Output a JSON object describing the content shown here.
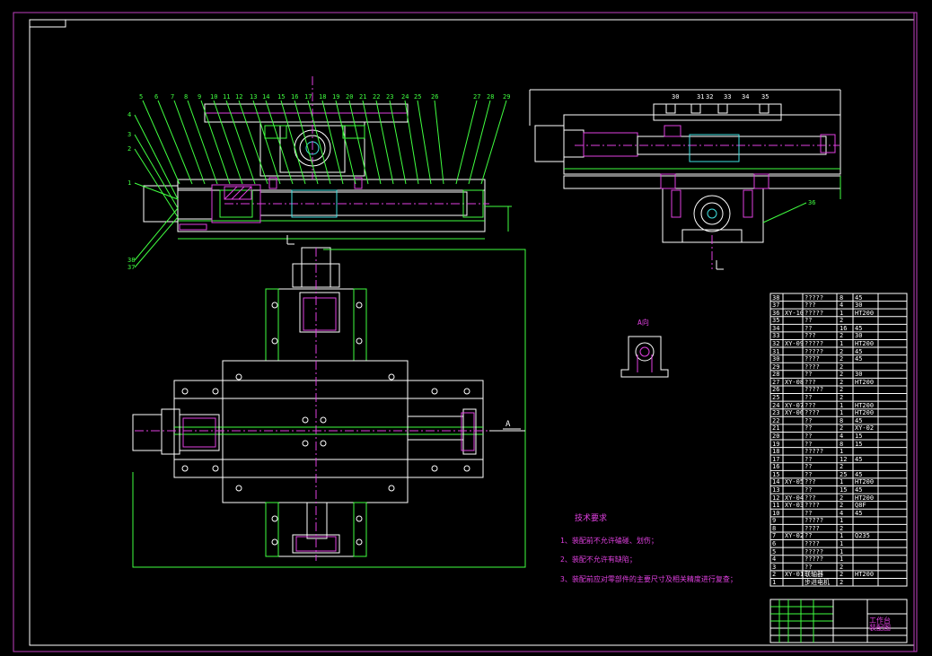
{
  "colors": {
    "background": "#000000",
    "outline": "#ffffff",
    "magenta": "#e040e0",
    "green": "#40ff40",
    "cyan": "#40e0e0",
    "blue": "#3060ff",
    "yellow": "#ffff40"
  },
  "leaders_top": [
    "5",
    "6",
    "7",
    "8",
    "9",
    "10",
    "11",
    "12",
    "13",
    "14",
    "15",
    "16",
    "17",
    "18",
    "19",
    "20",
    "21",
    "22",
    "23",
    "24",
    "25",
    "26",
    "27",
    "28",
    "29"
  ],
  "leaders_left": [
    "4",
    "3",
    "2",
    "1",
    "38",
    "37"
  ],
  "leaders_side": [
    "30",
    "31",
    "32",
    "33",
    "34",
    "35",
    "36"
  ],
  "view_label": "A向",
  "section_mark": "A",
  "notes": {
    "title": "技术要求",
    "items": [
      "1、装配前不允许磕碰、划伤；",
      "2、装配不允许有缺陷；",
      "3、装配前应对零部件的主要尺寸及相关精度进行复查；"
    ]
  },
  "bom": [
    {
      "no": "38",
      "code": "",
      "name": "?????",
      "qty": "8",
      "mat": "45"
    },
    {
      "no": "37",
      "code": "",
      "name": "???",
      "qty": "4",
      "mat": "30"
    },
    {
      "no": "36",
      "code": "XY-10",
      "name": "?????",
      "qty": "1",
      "mat": "HT200"
    },
    {
      "no": "35",
      "code": "",
      "name": "??",
      "qty": "2",
      "mat": ""
    },
    {
      "no": "34",
      "code": "",
      "name": "??",
      "qty": "16",
      "mat": "45"
    },
    {
      "no": "33",
      "code": "",
      "name": "???",
      "qty": "2",
      "mat": "30"
    },
    {
      "no": "32",
      "code": "XY-09",
      "name": "?????",
      "qty": "1",
      "mat": "HT200"
    },
    {
      "no": "31",
      "code": "",
      "name": "?????",
      "qty": "2",
      "mat": "45"
    },
    {
      "no": "30",
      "code": "",
      "name": "????",
      "qty": "2",
      "mat": "45"
    },
    {
      "no": "29",
      "code": "",
      "name": "????",
      "qty": "2",
      "mat": ""
    },
    {
      "no": "28",
      "code": "",
      "name": "??",
      "qty": "2",
      "mat": "30"
    },
    {
      "no": "27",
      "code": "XY-08",
      "name": "???",
      "qty": "2",
      "mat": "HT200"
    },
    {
      "no": "26",
      "code": "",
      "name": "?????",
      "qty": "2",
      "mat": ""
    },
    {
      "no": "25",
      "code": "",
      "name": "??",
      "qty": "2",
      "mat": ""
    },
    {
      "no": "24",
      "code": "XY-07",
      "name": "???",
      "qty": "1",
      "mat": "HT200"
    },
    {
      "no": "23",
      "code": "XY-06",
      "name": "????",
      "qty": "1",
      "mat": "HT200"
    },
    {
      "no": "22",
      "code": "",
      "name": "??",
      "qty": "8",
      "mat": "45"
    },
    {
      "no": "21",
      "code": "",
      "name": "??",
      "qty": "2",
      "mat": "XY-02"
    },
    {
      "no": "20",
      "code": "",
      "name": "??",
      "qty": "4",
      "mat": "15"
    },
    {
      "no": "19",
      "code": "",
      "name": "??",
      "qty": "8",
      "mat": "15"
    },
    {
      "no": "18",
      "code": "",
      "name": "?????",
      "qty": "1",
      "mat": ""
    },
    {
      "no": "17",
      "code": "",
      "name": "??",
      "qty": "12",
      "mat": "45"
    },
    {
      "no": "16",
      "code": "",
      "name": "??",
      "qty": "2",
      "mat": ""
    },
    {
      "no": "15",
      "code": "",
      "name": "??",
      "qty": "25",
      "mat": "45"
    },
    {
      "no": "14",
      "code": "XY-05",
      "name": "???",
      "qty": "1",
      "mat": "HT200"
    },
    {
      "no": "13",
      "code": "",
      "name": "??",
      "qty": "15",
      "mat": "45"
    },
    {
      "no": "12",
      "code": "XY-04",
      "name": "???",
      "qty": "2",
      "mat": "HT200"
    },
    {
      "no": "11",
      "code": "XY-03",
      "name": "????",
      "qty": "2",
      "mat": "Q8F"
    },
    {
      "no": "10",
      "code": "",
      "name": "??",
      "qty": "4",
      "mat": "45"
    },
    {
      "no": "9",
      "code": "",
      "name": "?????",
      "qty": "1",
      "mat": ""
    },
    {
      "no": "8",
      "code": "",
      "name": "????",
      "qty": "2",
      "mat": ""
    },
    {
      "no": "7",
      "code": "XY-02",
      "name": "??",
      "qty": "1",
      "mat": "Q235"
    },
    {
      "no": "6",
      "code": "",
      "name": "????",
      "qty": "1",
      "mat": ""
    },
    {
      "no": "5",
      "code": "",
      "name": "?????",
      "qty": "1",
      "mat": ""
    },
    {
      "no": "4",
      "code": "",
      "name": "?????",
      "qty": "1",
      "mat": ""
    },
    {
      "no": "3",
      "code": "",
      "name": "??",
      "qty": "2",
      "mat": ""
    },
    {
      "no": "2",
      "code": "XY-01",
      "name": "联轴器",
      "qty": "2",
      "mat": "HT200"
    },
    {
      "no": "1",
      "code": "",
      "name": "步进电机",
      "qty": "2",
      "mat": ""
    }
  ],
  "titleblock": {
    "line1": "工作台",
    "line2": "装配图"
  }
}
